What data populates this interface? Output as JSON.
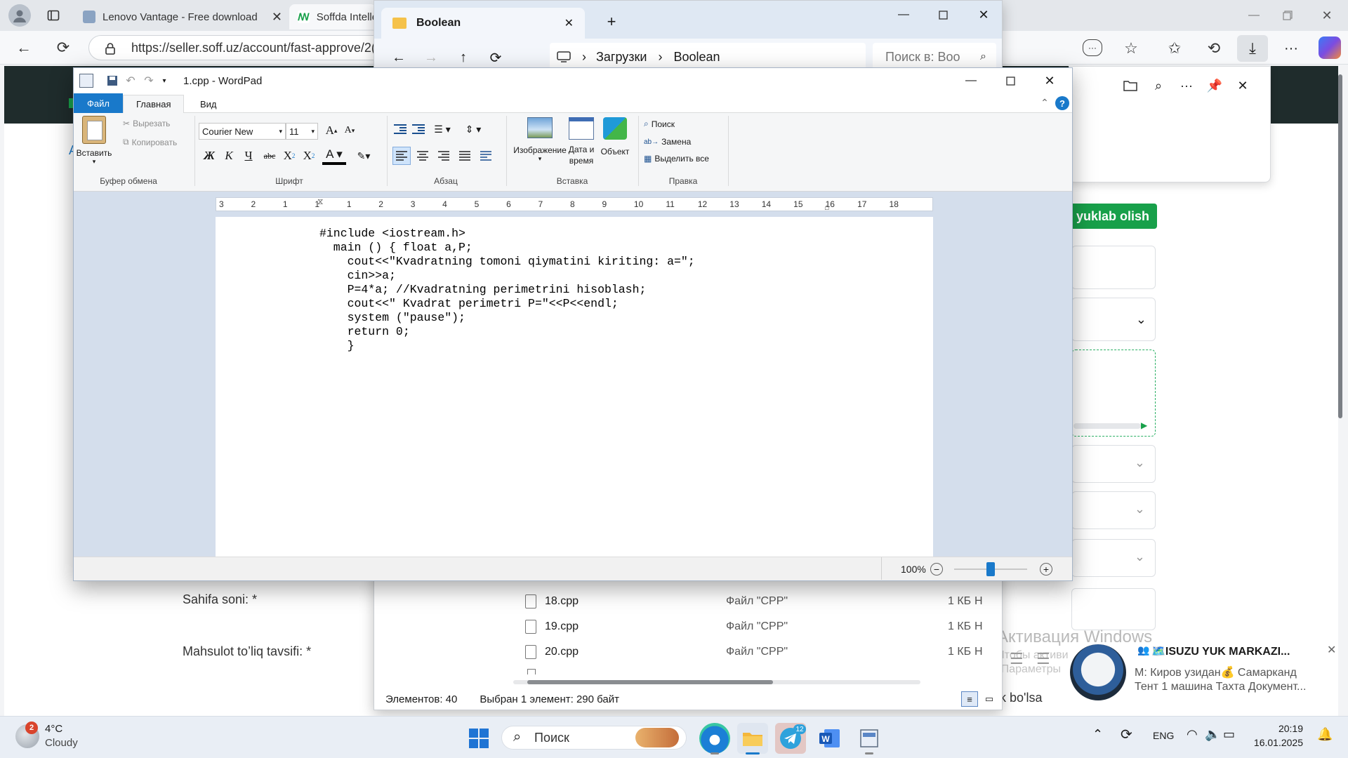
{
  "browser": {
    "tabs": [
      {
        "label": "Lenovo Vantage - Free download"
      },
      {
        "label": "Soffda Intelle"
      }
    ],
    "address": "https://seller.soff.uz/account/fast-approve/2("
  },
  "web_page": {
    "download_button": "yuklab olish",
    "labels": {
      "pages": "Sahifa soni: *",
      "description": "Mahsulot to’liq tavsifi: *",
      "footer_text": "k bo'lsa"
    },
    "watermark": {
      "title": "Активация Windows",
      "line1": "Чтобы активи",
      "line2": "\"Параметры"
    }
  },
  "explorer": {
    "tab_title": "Boolean",
    "breadcrumb": [
      "Загрузки",
      "Boolean"
    ],
    "search_placeholder": "Поиск в: Boo",
    "files": [
      {
        "name": "18.cpp",
        "type": "Файл \"CPP\"",
        "size": "1 КБ",
        "extra": "Н"
      },
      {
        "name": "19.cpp",
        "type": "Файл \"CPP\"",
        "size": "1 КБ",
        "extra": "Н"
      },
      {
        "name": "20.cpp",
        "type": "Файл \"CPP\"",
        "size": "1 КБ",
        "extra": "Н"
      }
    ],
    "status": {
      "count": "Элементов: 40",
      "selected": "Выбран 1 элемент: 290 байт"
    }
  },
  "wordpad": {
    "title": "1.cpp - WordPad",
    "tabs": {
      "file": "Файл",
      "home": "Главная",
      "view": "Вид"
    },
    "clipboard": {
      "paste": "Вставить",
      "cut": "Вырезать",
      "copy": "Копировать",
      "group": "Буфер обмена"
    },
    "font": {
      "name": "Courier New",
      "size": "11",
      "group": "Шрифт",
      "bold": "Ж",
      "italic": "К",
      "underline": "Ч",
      "strike": "abc"
    },
    "paragraph": {
      "group": "Абзац"
    },
    "insert": {
      "image": "Изображение",
      "datetime_1": "Дата и",
      "datetime_2": "время",
      "object": "Объект",
      "group": "Вставка"
    },
    "editing": {
      "find": "Поиск",
      "replace": "Замена",
      "select_all": "Выделить все",
      "group": "Правка"
    },
    "ruler_marks": [
      "3",
      "2",
      "1",
      "1",
      "1",
      "2",
      "3",
      "4",
      "5",
      "6",
      "7",
      "8",
      "9",
      "10",
      "11",
      "12",
      "13",
      "14",
      "15",
      "16",
      "17",
      "18"
    ],
    "document_text": "#include <iostream.h>\n  main () { float a,P;\n    cout<<\"Kvadratning tomoni qiymatini kiriting: a=\";\n    cin>>a;\n    P=4*a; //Kvadratning perimetrini hisoblash;\n    cout<<\" Kvadrat perimetri P=\"<<P<<endl;\n    system (\"pause\");\n    return 0;\n    }",
    "zoom": "100%",
    "zoom_level": 0.5
  },
  "notification": {
    "title": "🗺️ISUZU YUK MARKAZI...",
    "line1": "M: Киров узидан💰 Самарканд",
    "line2": "Тент 1 машина  Тахта Документ..."
  },
  "taskbar": {
    "weather_badge": "2",
    "weather_temp": "4°C",
    "weather_desc": "Cloudy",
    "search": "Поиск",
    "telegram_badge": "12",
    "language": "ENG",
    "time": "20:19",
    "date": "16.01.2025"
  },
  "colors": {
    "accent": "#1979ca",
    "green": "#18a04a",
    "dark_header": "#1f2c2c"
  }
}
